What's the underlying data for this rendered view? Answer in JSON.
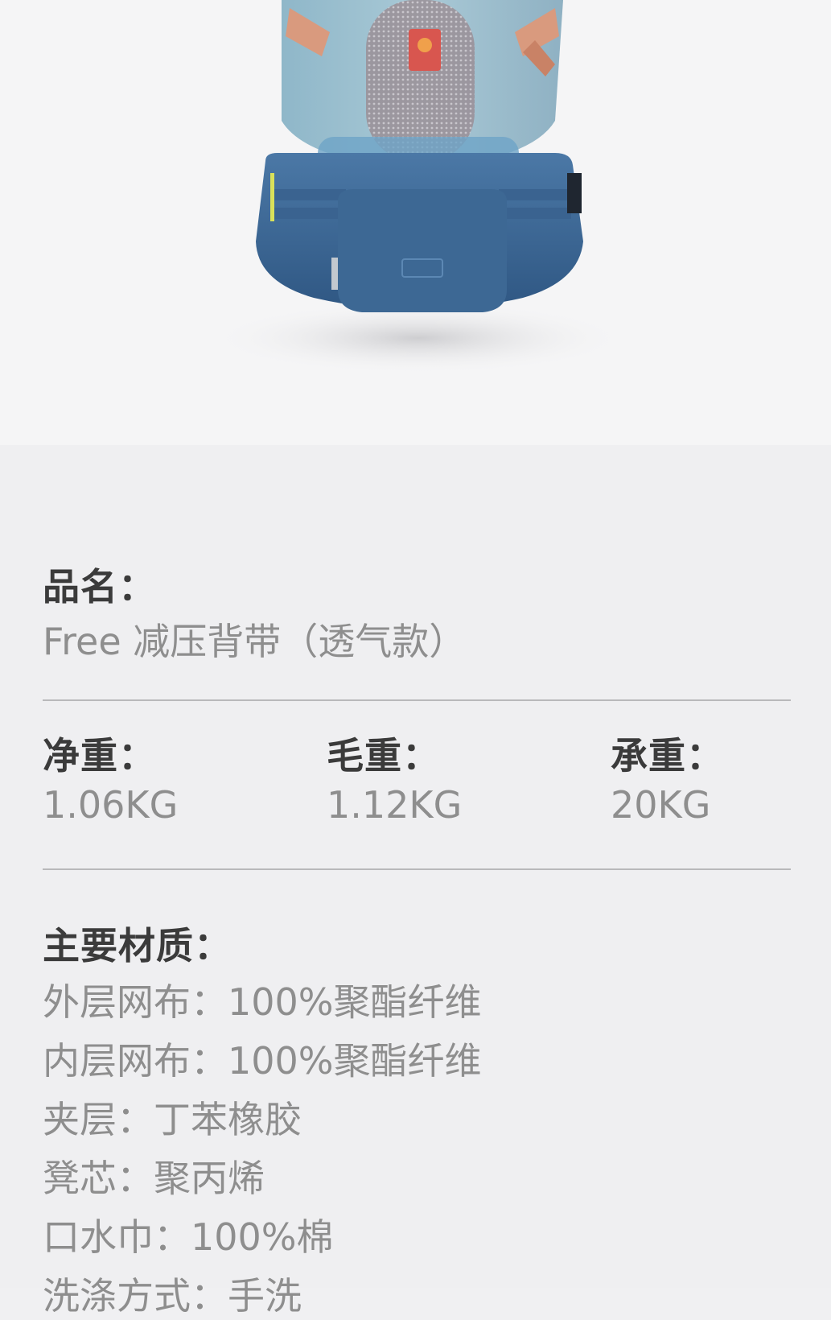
{
  "product_image": {
    "alt": "baby hip seat carrier"
  },
  "product_name": {
    "label": "品名：",
    "value": "Free 减压背带（透气款）"
  },
  "weights": {
    "net": {
      "label": "净重：",
      "value": "1.06KG"
    },
    "gross": {
      "label": "毛重：",
      "value": "1.12KG"
    },
    "load": {
      "label": "承重：",
      "value": "20KG"
    }
  },
  "materials": {
    "label": "主要材质：",
    "lines": [
      "外层网布：100%聚酯纤维",
      "内层网布：100%聚酯纤维",
      "夹层：丁苯橡胶",
      "凳芯：聚丙烯",
      "口水巾：100%棉",
      "洗涤方式：手洗"
    ]
  },
  "colors": {
    "panel_bg": "#efeff1",
    "label_text": "#3b3b3b",
    "value_text": "#8e8e8e",
    "carrier_blue": "#3f6a98"
  }
}
